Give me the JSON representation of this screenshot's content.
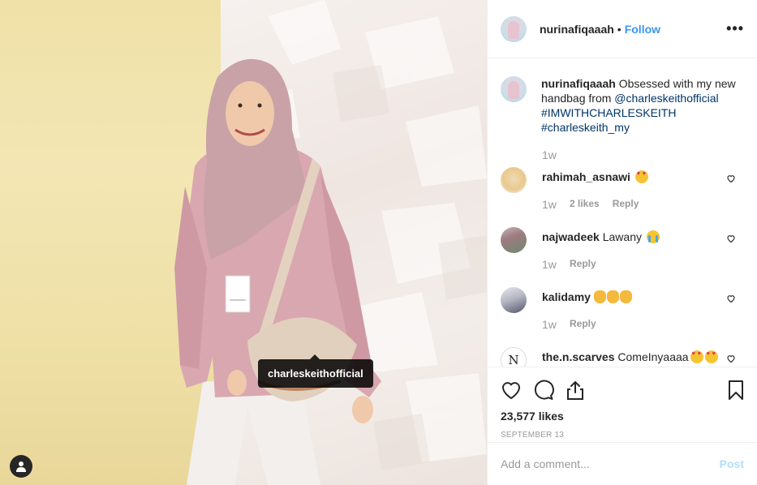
{
  "photo": {
    "tag_username": "charleskeithofficial",
    "user_tag_icon": "person-icon"
  },
  "header": {
    "username": "nurinafiqaaah",
    "separator": "•",
    "follow_label": "Follow",
    "more_label": "•••"
  },
  "caption": {
    "username": "nurinafiqaaah",
    "text": "Obsessed with my new handbag from",
    "mention": "@charleskeithofficial",
    "hashtags": [
      "#IMWITHCHARLESKEITH",
      "#charleskeith_my"
    ],
    "time": "1w"
  },
  "comments": [
    {
      "username": "rahimah_asnawi",
      "text": "",
      "emoji": [
        "heart-eyes-emoji"
      ],
      "time": "1w",
      "likes": "2 likes",
      "reply": "Reply"
    },
    {
      "username": "najwadeek",
      "text": "Lawany",
      "emoji": [
        "crying-emoji"
      ],
      "time": "1w",
      "likes": "",
      "reply": "Reply"
    },
    {
      "username": "kalidamy",
      "text": "",
      "emoji": [
        "clap-emoji",
        "clap-emoji",
        "clap-emoji"
      ],
      "time": "1w",
      "likes": "",
      "reply": "Reply"
    },
    {
      "username": "the.n.scarves",
      "text": "ComeInyaaaa",
      "emoji": [
        "heart-eyes-emoji",
        "heart-eyes-emoji"
      ],
      "avatar_letter": "N",
      "time": "",
      "likes": "",
      "reply": ""
    }
  ],
  "actions": {
    "likes": "23,577 likes",
    "date": "SEPTEMBER 13"
  },
  "add_comment": {
    "placeholder": "Add a comment...",
    "post_label": "Post"
  },
  "colors": {
    "follow": "#3897f0",
    "link": "#003569",
    "muted": "#999999",
    "post_disabled": "#b2dffc"
  }
}
